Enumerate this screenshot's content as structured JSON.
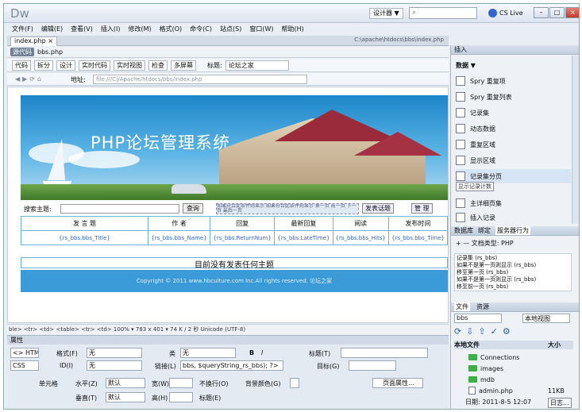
{
  "app": {
    "logo": "Dw",
    "design_label": "设计器 ▼",
    "cslive": "CS Live"
  },
  "menu": [
    "文件(F)",
    "编辑(E)",
    "查看(V)",
    "插入(I)",
    "修改(M)",
    "格式(O)",
    "命令(C)",
    "站点(S)",
    "窗口(W)",
    "帮助(H)"
  ],
  "doc": {
    "tab": "index.php ×",
    "path": "C:\\apache\\htdocs\\bbs\\index.php",
    "source_btn": "源代码",
    "source_file": "bbs.php"
  },
  "toolbar": {
    "code": "代码",
    "split": "拆分",
    "design": "设计",
    "live_code": "实时代码",
    "live_view": "实时视图",
    "inspect": "检查",
    "multiscreen": "多屏幕",
    "title_label": "标题:",
    "title_value": "论坛之家"
  },
  "address": {
    "label": "地址:",
    "url": "file:///C|/Apache/htdocs/bbs/index.php"
  },
  "page": {
    "banner_title": "PHP论坛管理系统",
    "search_label": "搜索主题:",
    "query_button": "查询",
    "hint_text": "如果符合此条件则显示 如果符合此条件则显示 第一页 前一页 下一页 最后一页",
    "post_button": "发表话题",
    "manage_button": "管 理",
    "columns": [
      "发 言 题",
      "作 者",
      "回复",
      "最新回复",
      "阅读",
      "发布时间"
    ],
    "row": [
      "{rs_bbs.bbs_Title}",
      "{rs_bbs.bbs_Name}",
      "{rs_bbs.ReturnNum}",
      "{rs_bbs.LateTime}",
      "{rs_bbs.bbs_Hits}",
      "{rs_bbs.bbs_Time}"
    ],
    "row_hint": "如果符合此条件则显示...",
    "no_post": "目前没有发表任何主题",
    "copyright": "Copyright © 2011 www.hbculture.com Inc.All rights reserved. 论坛之家"
  },
  "status": "ble> <tr> <td> <table> <tr> <td>  100%  ▾ 783 x 401 ▾ 74 K / 2 秒 Unicode (UTF-8)",
  "props": {
    "header": "属性",
    "html_btn": "<> HTML",
    "css_btn": "CSS",
    "format_label": "格式(F)",
    "format_value": "无",
    "class_label": "类",
    "class_value": "无",
    "id_label": "ID(I)",
    "id_value": "无",
    "link_label": "链接(L)",
    "link_value": "bbs, $queryString_rs_bbs); ?>",
    "target_label": "目标(G)",
    "title_label": "标题(T)",
    "cell_label": "单元格",
    "horz_label": "水平(Z)",
    "horz_value": "默认",
    "vert_label": "垂直(T)",
    "vert_value": "默认",
    "width_label": "宽(W)",
    "height_label": "高(H)",
    "nowrap_label": "不换行(O)",
    "header_label": "标题(E)",
    "bg_label": "背景颜色(G)",
    "page_props": "页面属性..."
  },
  "insert": {
    "header": "插入",
    "category": "数据 ▼",
    "items": [
      "Spry 重复项",
      "Spry 重复列表",
      "记录集",
      "动态数据",
      "重复区域",
      "显示区域",
      "记录集分页",
      "显示记录计数",
      "主详细页集",
      "插入记录"
    ],
    "tooltip": "显示记录计数"
  },
  "behaviors": {
    "tabs": [
      "数据库",
      "绑定",
      "服务器行为"
    ],
    "doc_type": "+ — 文档类型: PHP",
    "items": [
      "记录集 (rs_bbs)",
      "如果不是第一页则显示 (rs_bbs)",
      "移至第一页 (rs_bbs)",
      "如果不是第一页则显示 (rs_bbs)",
      "移至前一页 (rs_bbs)"
    ]
  },
  "files": {
    "tabs": [
      "文件",
      "资源"
    ],
    "site": "bbs",
    "view": "本地视图",
    "col_local": "本地文件",
    "col_size": "大小",
    "items": [
      {
        "name": "Connections",
        "size": ""
      },
      {
        "name": "images",
        "size": ""
      },
      {
        "name": "mdb",
        "size": ""
      },
      {
        "name": "admin.php",
        "size": "11KB"
      }
    ],
    "date": "日期: 2011-8-5 12:07",
    "log": "日志..."
  },
  "colors": {
    "accent": "#1d86c9",
    "grid": "#6bb6d6"
  }
}
